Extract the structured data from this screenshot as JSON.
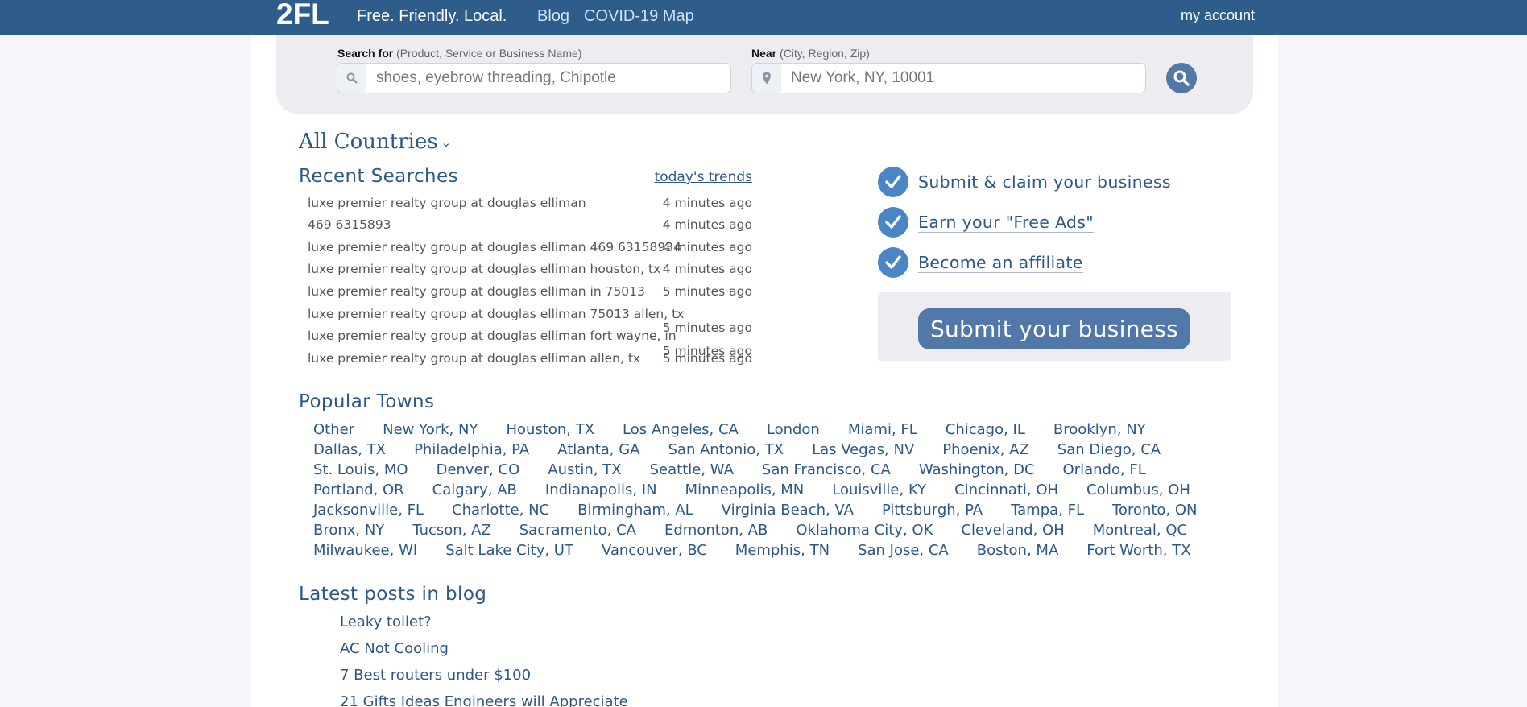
{
  "header": {
    "logo": "2FL",
    "tagline": "Free. Friendly. Local.",
    "nav": [
      "Blog",
      "COVID-19 Map"
    ],
    "account": "my account"
  },
  "search": {
    "what_label": "Search for",
    "what_hint": "(Product, Service or Business Name)",
    "what_placeholder": "shoes, eyebrow threading, Chipotle",
    "near_label": "Near",
    "near_hint": "(City, Region, Zip)",
    "near_placeholder": "New York, NY, 10001"
  },
  "country_selector": "All Countries",
  "recent": {
    "title": "Recent Searches",
    "trends_link": "today's trends",
    "items": [
      {
        "query": "luxe premier realty group at douglas elliman",
        "time": "4 minutes ago"
      },
      {
        "query": "469 6315893",
        "time": "4 minutes ago"
      },
      {
        "query": "luxe premier realty group at douglas elliman 469 63158934",
        "time": "4 minutes ago"
      },
      {
        "query": "luxe premier realty group at douglas elliman houston, tx",
        "time": "4 minutes ago"
      },
      {
        "query": "luxe premier realty group at douglas elliman in 75013",
        "time": "5 minutes ago"
      },
      {
        "query": "luxe premier realty group at douglas elliman 75013 allen, tx",
        "time": "5 minutes ago"
      },
      {
        "query": "luxe premier realty group at douglas elliman fort wayne, in",
        "time": "5 minutes ago"
      },
      {
        "query": "luxe premier realty group at douglas elliman allen, tx",
        "time": "5 minutes ago"
      }
    ]
  },
  "aside": {
    "items": [
      "Submit & claim your business",
      "Earn your \"Free Ads\"",
      "Become an affiliate"
    ],
    "submit_button": "Submit your business"
  },
  "popular_towns": {
    "title": "Popular Towns",
    "rows": [
      [
        "Other",
        "New York, NY",
        "Houston, TX",
        "Los Angeles, CA",
        "London",
        "Miami, FL",
        "Chicago, IL",
        "Brooklyn, NY"
      ],
      [
        "Dallas, TX",
        "Philadelphia, PA",
        "Atlanta, GA",
        "San Antonio, TX",
        "Las Vegas, NV",
        "Phoenix, AZ",
        "San Diego, CA"
      ],
      [
        "St. Louis, MO",
        "Denver, CO",
        "Austin, TX",
        "Seattle, WA",
        "San Francisco, CA",
        "Washington, DC",
        "Orlando, FL"
      ],
      [
        "Portland, OR",
        "Calgary, AB",
        "Indianapolis, IN",
        "Minneapolis, MN",
        "Louisville, KY",
        "Cincinnati, OH",
        "Columbus, OH"
      ],
      [
        "Jacksonville, FL",
        "Charlotte, NC",
        "Birmingham, AL",
        "Virginia Beach, VA",
        "Pittsburgh, PA",
        "Tampa, FL",
        "Toronto, ON"
      ],
      [
        "Bronx, NY",
        "Tucson, AZ",
        "Sacramento, CA",
        "Edmonton, AB",
        "Oklahoma City, OK",
        "Cleveland, OH",
        "Montreal, QC"
      ],
      [
        "Milwaukee, WI",
        "Salt Lake City, UT",
        "Vancouver, BC",
        "Memphis, TN",
        "San Jose, CA",
        "Boston, MA",
        "Fort Worth, TX"
      ]
    ]
  },
  "blog": {
    "title": "Latest posts in blog",
    "posts": [
      "Leaky toilet?",
      "AC Not Cooling",
      "7 Best routers under $100",
      "21 Gifts Ideas Engineers will Appreciate"
    ]
  },
  "colors": {
    "header_bg": "#2e5d8c",
    "link": "#2d5885",
    "button": "#5278a8",
    "check": "#4a86c5"
  }
}
